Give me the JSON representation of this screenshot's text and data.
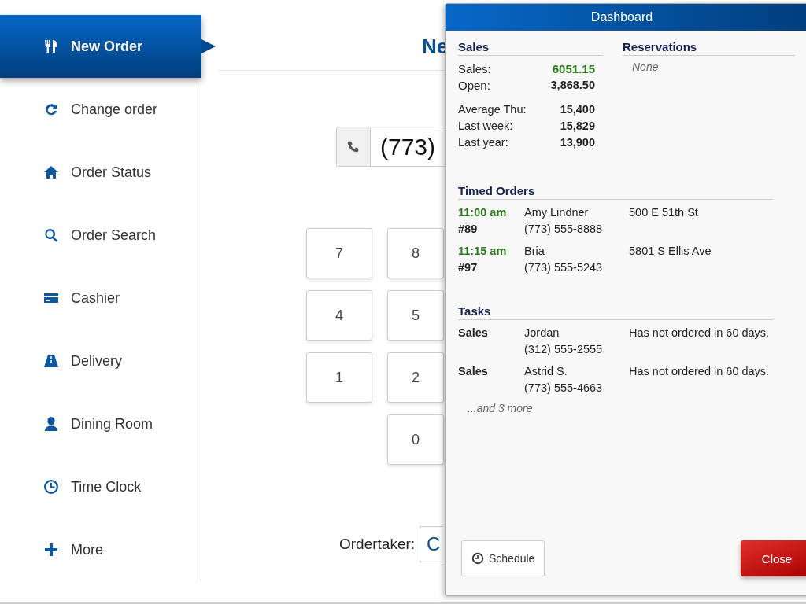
{
  "sidebar": {
    "items": [
      {
        "label": "New Order",
        "selected": true
      },
      {
        "label": "Change order",
        "selected": false
      },
      {
        "label": "Order Status",
        "selected": false
      },
      {
        "label": "Order Search",
        "selected": false
      },
      {
        "label": "Cashier",
        "selected": false
      },
      {
        "label": "Delivery",
        "selected": false
      },
      {
        "label": "Dining Room",
        "selected": false
      },
      {
        "label": "Time Clock",
        "selected": false
      },
      {
        "label": "More",
        "selected": false
      }
    ]
  },
  "main": {
    "title": "Ne",
    "phone": {
      "value": "(773)"
    },
    "keypad": [
      [
        "7",
        "8"
      ],
      [
        "4",
        "5"
      ],
      [
        "1",
        "2"
      ],
      [
        "0"
      ]
    ],
    "ordertaker": {
      "label": "Ordertaker:",
      "value": "C"
    }
  },
  "dashboard": {
    "title": "Dashboard",
    "sales": {
      "heading": "Sales",
      "rows": [
        {
          "label": "Sales:",
          "value": "6051.15",
          "kind": "sales"
        },
        {
          "label": "Open:",
          "value": "3,868.50",
          "kind": "open"
        },
        {
          "label": "Average Thu:",
          "value": "15,400",
          "kind": "comparison"
        },
        {
          "label": "Last week:",
          "value": "15,829",
          "kind": "comparison"
        },
        {
          "label": "Last year:",
          "value": "13,900",
          "kind": "comparison"
        }
      ]
    },
    "reservations": {
      "heading": "Reservations",
      "empty": "None"
    },
    "timed_orders": {
      "heading": "Timed Orders",
      "rows": [
        {
          "time": "11:00 am",
          "number": "#89",
          "name": "Amy Lindner",
          "phone": "(773) 555-8888",
          "address": "500 E 51th St"
        },
        {
          "time": "11:15 am",
          "number": "#97",
          "name": "Bria",
          "phone": "(773) 555-5243",
          "address": "5801 S Ellis Ave"
        }
      ]
    },
    "tasks": {
      "heading": "Tasks",
      "rows": [
        {
          "type": "Sales",
          "name": "Jordan",
          "phone": "(312) 555-2555",
          "note": "Has not ordered in 60 days."
        },
        {
          "type": "Sales",
          "name": "Astrid S.",
          "phone": "(773) 555-4663",
          "note": "Has not ordered in 60 days."
        }
      ],
      "more": "...and 3 more"
    },
    "schedule_button": "Schedule",
    "close_button": "Close"
  }
}
